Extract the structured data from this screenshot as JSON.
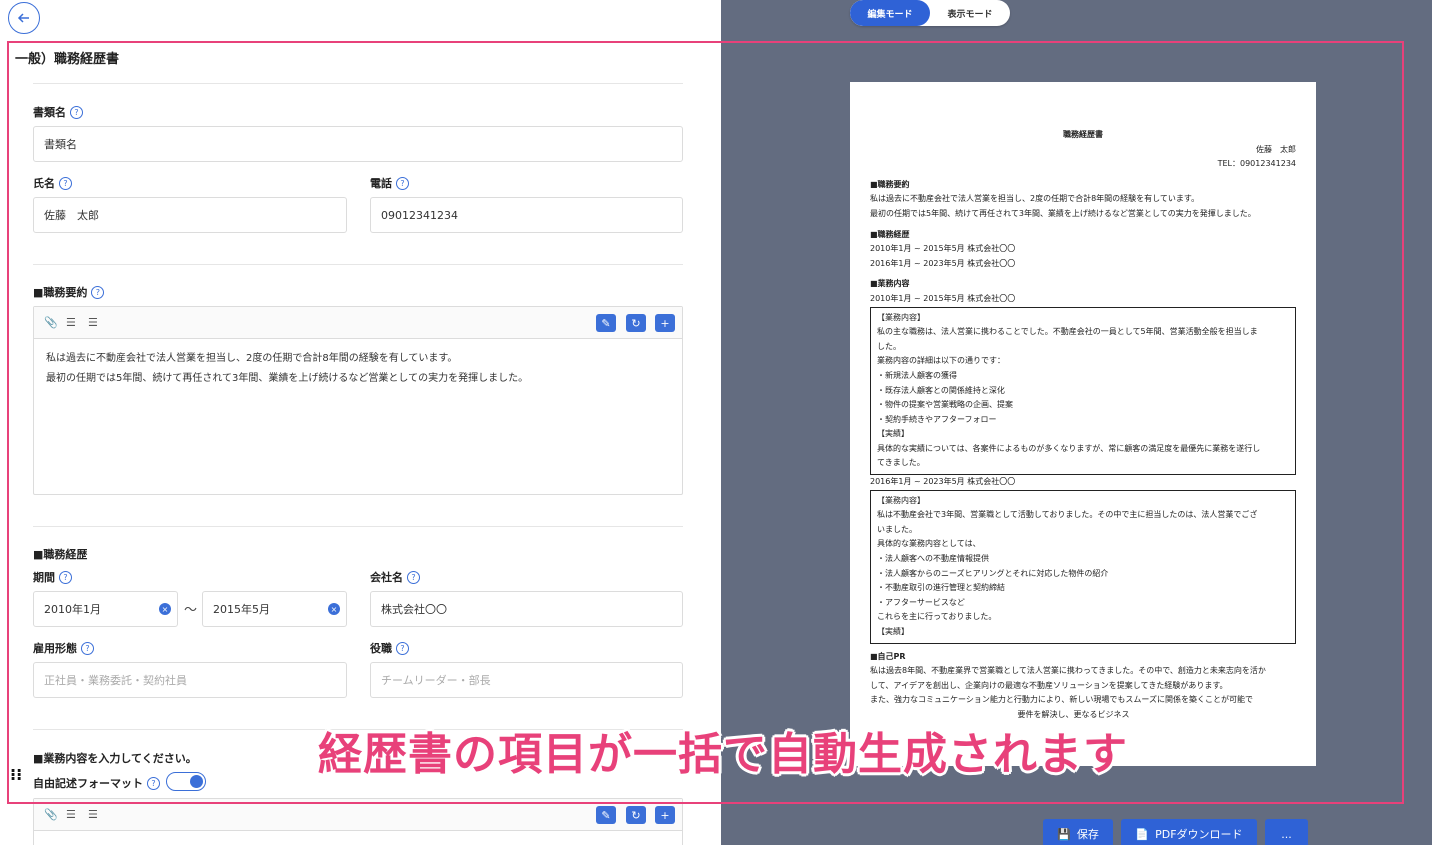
{
  "editor": {
    "doc_title": "一般）職務経歴書",
    "fields": {
      "doc_name_label": "書類名",
      "doc_name_value": "書類名",
      "name_label": "氏名",
      "name_value": "佐藤　太郎",
      "phone_label": "電話",
      "phone_value": "09012341234"
    },
    "summary": {
      "label": "■職務要約",
      "lines": [
        "私は過去に不動産会社で法人営業を担当し、2度の任期で合計8年間の経験を有しています。",
        "最初の任期では5年間、続けて再任されて3年間、業績を上げ続けるなど営業としての実力を発揮しました。"
      ]
    },
    "history": {
      "label": "■職務経歴",
      "period_label": "期間",
      "start": "2010年1月",
      "tilde": "〜",
      "end": "2015年5月",
      "company_label": "会社名",
      "company_value": "株式会社〇〇",
      "employment_label": "雇用形態",
      "employment_placeholder": "正社員・業務委託・契約社員",
      "position_label": "役職",
      "position_placeholder": "チームリーダー・部長"
    },
    "duties": {
      "label": "■業務内容を入力してください。",
      "freeform_label": "自由記述フォーマット"
    },
    "icons": {
      "help": "?",
      "clear": "×",
      "edit": "✎",
      "refresh": "↻",
      "add": "+",
      "attach": "✎",
      "ordered_list": "☰",
      "bullet_list": "☰"
    }
  },
  "preview": {
    "mode_edit": "編集モード",
    "mode_view": "表示モード",
    "paper": {
      "title": "職務経歴書",
      "name": "佐藤　太郎",
      "tel": "TEL：09012341234",
      "summary_head": "■職務要約",
      "summary_1": "私は過去に不動産会社で法人営業を担当し、2度の任期で合計8年間の経験を有しています。",
      "summary_2": "最初の任期では5年間、続けて再任されて3年間、業績を上げ続けるなど営業としての実力を発揮しました。",
      "history_head": "■職務経歴",
      "history_1": "2010年1月 ~ 2015年5月  株式会社〇〇",
      "history_2": "2016年1月 ~ 2023年5月  株式会社〇〇",
      "duties_head": "■業務内容",
      "block1_head": "2010年1月 ~ 2015年5月  株式会社〇〇",
      "block1_lines": [
        "【業務内容】",
        "私の主な職務は、法人営業に携わることでした。不動産会社の一員として5年間、営業活動全般を担当しま",
        "した。",
        "業務内容の詳細は以下の通りです：",
        "・新規法人顧客の獲得",
        "・既存法人顧客との関係維持と深化",
        "・物件の提案や営業戦略の企画、提案",
        "・契約手続きやアフターフォロー",
        "【実績】",
        "具体的な実績については、各案件によるものが多くなりますが、常に顧客の満足度を最優先に業務を遂行し",
        "てきました。"
      ],
      "block2_head": "2016年1月 ~ 2023年5月  株式会社〇〇",
      "block2_lines": [
        "【業務内容】",
        "私は不動産会社で3年間、営業職として活動しておりました。その中で主に担当したのは、法人営業でござ",
        "いました。",
        "具体的な業務内容としては、",
        "・法人顧客への不動産情報提供",
        "・法人顧客からのニーズヒアリングとそれに対応した物件の紹介",
        "・不動産取引の進行管理と契約締結",
        "・アフターサービスなど",
        "これらを主に行っておりました。",
        "【実績】"
      ],
      "pr_head": "■自己PR",
      "pr_1": "私は過去8年間、不動産業界で営業職として法人営業に携わってきました。その中で、創造力と未来志向を活か",
      "pr_2": "して、アイデアを創出し、企業向けの最適な不動産ソリューションを提案してきた経験があります。",
      "pr_3": "また、強力なコミュニケーション能力と行動力により、新しい現場でもスムーズに関係を築くことが可能で",
      "pr_4": "                                                          要件を解決し、更なるビジネス"
    },
    "buttons": {
      "save": "保存",
      "pdf": "PDFダウンロード",
      "more": "..."
    }
  },
  "overlay": {
    "banner": "経歴書の項目が一括で自動生成されます"
  },
  "colors": {
    "accent": "#2f62d6",
    "preview_bg": "#636c80",
    "highlight": "#e8417a"
  }
}
